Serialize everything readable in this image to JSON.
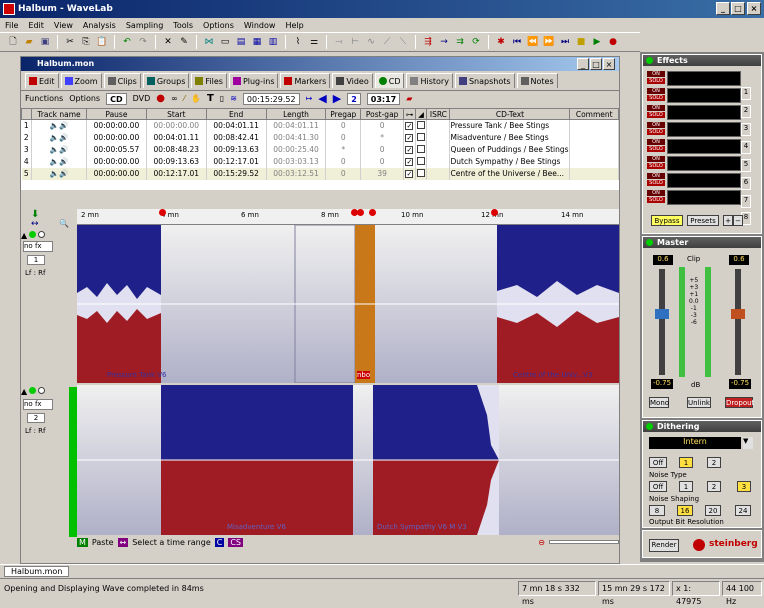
{
  "window": {
    "title": "Halbum - WaveLab",
    "min": "_",
    "max": "□",
    "close": "×"
  },
  "menu": [
    "File",
    "Edit",
    "View",
    "Analysis",
    "Sampling",
    "Tools",
    "Options",
    "Window",
    "Help"
  ],
  "doc": {
    "title": "Halbum.mon"
  },
  "tabs": [
    {
      "label": "Edit",
      "color": "#c00000"
    },
    {
      "label": "Zoom",
      "color": "#4040ff"
    },
    {
      "label": "Clips",
      "color": "#606060"
    },
    {
      "label": "Groups",
      "color": "#006060"
    },
    {
      "label": "Files",
      "color": "#808000"
    },
    {
      "label": "Plug-ins",
      "color": "#a000a0"
    },
    {
      "label": "Markers",
      "color": "#c00000"
    },
    {
      "label": "Video",
      "color": "#404040"
    },
    {
      "label": "CD",
      "color": "#008000"
    },
    {
      "label": "History",
      "color": "#808080"
    },
    {
      "label": "Snapshots",
      "color": "#404080"
    },
    {
      "label": "Notes",
      "color": "#606060"
    }
  ],
  "func": {
    "functions": "Functions",
    "options": "Options",
    "cd": "CD",
    "dvd": "DVD",
    "time": "00:15:29.52",
    "count": "2",
    "total": "03:17"
  },
  "table": {
    "headers": [
      "Track name",
      "Pause",
      "Start",
      "End",
      "Length",
      "Pregap",
      "Post-gap",
      "",
      "",
      "ISRC",
      "CD-Text",
      "Comment"
    ],
    "rows": [
      {
        "n": "1",
        "pause": "00:00:00.00",
        "start": "00:00:00.00",
        "end": "00:04:01.11",
        "len": "00:04:01.11",
        "pre": "0",
        "post": "0",
        "text": "Pressure Tank / Bee Stings"
      },
      {
        "n": "2",
        "pause": "00:00:00.00",
        "start": "00:04:01.11",
        "end": "00:08:42.41",
        "len": "00:04:41.30",
        "pre": "0",
        "post": "*",
        "text": "Misadventure / Bee Stings"
      },
      {
        "n": "3",
        "pause": "00:00:05.57",
        "start": "00:08:48.23",
        "end": "00:09:13.63",
        "len": "00:00:25.40",
        "pre": "*",
        "post": "0",
        "text": "Queen of Puddings / Bee Stings"
      },
      {
        "n": "4",
        "pause": "00:00:00.00",
        "start": "00:09:13.63",
        "end": "00:12:17.01",
        "len": "00:03:03.13",
        "pre": "0",
        "post": "0",
        "text": "Dutch Sympathy / Bee Stings"
      },
      {
        "n": "5",
        "pause": "00:00:00.00",
        "start": "00:12:17.01",
        "end": "00:15:29.52",
        "len": "00:03:12.51",
        "pre": "0",
        "post": "39",
        "text": "Centre of the Universe / Bee..."
      }
    ]
  },
  "ruler": [
    "2 mn",
    "4 mn",
    "6 mn",
    "8 mn",
    "10 mn",
    "12 mn",
    "14 mn"
  ],
  "tracks": [
    {
      "fx": "no fx",
      "num": "1",
      "ch": "Lf : Rf",
      "clips": [
        "Pressure Tank V6",
        "Misadventure V6",
        "nbo",
        "Centre of the Univ...V3"
      ]
    },
    {
      "fx": "no fx",
      "num": "2",
      "ch": "Lf : Rf",
      "clips": [
        "Misadventure V6",
        "Dutch Sympathy V6 M V3"
      ]
    }
  ],
  "bottombar": {
    "paste": "Paste",
    "select": "Select a time range",
    "c": "C",
    "cs": "CS"
  },
  "effects": {
    "title": "Effects",
    "on": "ON",
    "solo": "SOLO",
    "slots": [
      "1",
      "2",
      "3",
      "4",
      "5",
      "6",
      "7",
      "8"
    ],
    "bypass": "Bypass",
    "presets": "Presets"
  },
  "master": {
    "title": "Master",
    "left": "0.6",
    "right": "0.6",
    "clip": "Clip",
    "peakL": "-0.75",
    "peakR": "-0.75",
    "db": "dB",
    "mono": "Mono",
    "unlink": "Unlink",
    "dropout": "Dropout",
    "scale": [
      "+5",
      "+3",
      "+1",
      "0.0",
      "-1",
      "-3",
      "-6"
    ]
  },
  "dither": {
    "title": "Dithering",
    "type": "Intern",
    "noise_type": "Noise  Type",
    "noise_shaping": "Noise  Shaping",
    "bits": "Output Bit Resolution",
    "off": "Off",
    "t1": "1",
    "t2": "2",
    "s1": "1",
    "s2": "2",
    "s3": "3",
    "b8": "8",
    "b16": "16",
    "b20": "20",
    "b24": "24"
  },
  "render": {
    "render": "Render",
    "steinberg": "steinberg"
  },
  "doctab": "Halbum.mon",
  "status": {
    "msg": "Opening and Displaying Wave completed in 84ms",
    "pos": "7 mn 18 s 332 ms",
    "len": "15 mn 29 s 172 ms",
    "zoom": "x 1: 47975",
    "rate": "44 100 Hz"
  }
}
